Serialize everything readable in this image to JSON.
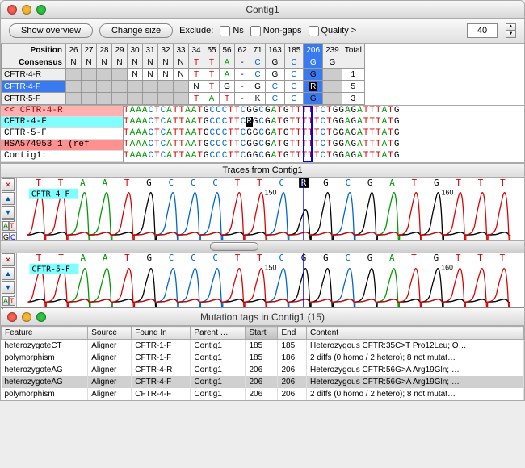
{
  "window": {
    "title": "Contig1"
  },
  "toolbar": {
    "overview_label": "Show overview",
    "changesize_label": "Change size",
    "exclude_label": "Exclude:",
    "ns_label": "Ns",
    "nongaps_label": "Non-gaps",
    "quality_label": "Quality >",
    "quality_value": "40"
  },
  "postable": {
    "position_label": "Position",
    "consensus_label": "Consensus",
    "columns": [
      {
        "pos": "26",
        "cons": "N"
      },
      {
        "pos": "27",
        "cons": "N"
      },
      {
        "pos": "28",
        "cons": "N"
      },
      {
        "pos": "29",
        "cons": "N"
      },
      {
        "pos": "30",
        "cons": "N"
      },
      {
        "pos": "31",
        "cons": "N"
      },
      {
        "pos": "32",
        "cons": "N"
      },
      {
        "pos": "33",
        "cons": "N"
      },
      {
        "pos": "34",
        "cons": "T"
      },
      {
        "pos": "55",
        "cons": "T"
      },
      {
        "pos": "56",
        "cons": "A"
      },
      {
        "pos": "62",
        "cons": "-"
      },
      {
        "pos": "71",
        "cons": "C"
      },
      {
        "pos": "163",
        "cons": "G"
      },
      {
        "pos": "185",
        "cons": "C"
      },
      {
        "pos": "206",
        "cons": "G",
        "hl": true
      },
      {
        "pos": "239",
        "cons": "G"
      }
    ],
    "total_label": "Total",
    "rows": [
      {
        "name": "CFTR-4-R",
        "cells": [
          "",
          "",
          "",
          "",
          "N",
          "N",
          "N",
          "N",
          "T",
          "T",
          "A",
          "-",
          "C",
          "G",
          "C",
          "G",
          ""
        ],
        "total": "1"
      },
      {
        "name": "CFTR-4-F",
        "hl": true,
        "cells": [
          "",
          "",
          "",
          "",
          "",
          "",
          "",
          "",
          "N",
          "T",
          "G",
          "-",
          "G",
          "C",
          "C",
          "R",
          ""
        ],
        "total": "5"
      },
      {
        "name": "CFTR-5-F",
        "cells": [
          "",
          "",
          "",
          "",
          "",
          "",
          "",
          "",
          "T",
          "A",
          "T",
          "-",
          "K",
          "C",
          "C",
          "G",
          ""
        ],
        "total": "3"
      }
    ]
  },
  "alignment": {
    "left": [
      {
        "label": "<< CFTR-4-R",
        "cls": "al-r"
      },
      {
        "label": "CFTR-4-F",
        "cls": "al-f"
      },
      {
        "label": "CFTR-5-F",
        "cls": ""
      },
      {
        "label": "HSA574953 1 (ref",
        "cls": "al-ref"
      },
      {
        "label": "Contig1:",
        "cls": ""
      }
    ],
    "cols": [
      "T",
      "A",
      "A",
      "A",
      "C",
      "T",
      "C",
      "A",
      "T",
      "T",
      "A",
      "A",
      "T",
      "G",
      "C",
      "C",
      "C",
      "T",
      "T",
      "C",
      "R",
      "G",
      "C",
      "G",
      "A",
      "T",
      "G",
      "T",
      "T",
      "T",
      "T",
      "T",
      "C",
      "T",
      "G",
      "G",
      "A",
      "G",
      "A",
      "T",
      "T",
      "T",
      "A",
      "T",
      "G"
    ],
    "variant": {
      "row1": "R",
      "row3": "G"
    }
  },
  "traces": {
    "header": "Traces from Contig1",
    "trace1": {
      "name": "CFTR-4-F",
      "bases": [
        "T",
        "T",
        "A",
        "A",
        "T",
        "G",
        "C",
        "C",
        "C",
        "T",
        "T",
        "C",
        "R",
        "G",
        "C",
        "G",
        "A",
        "T",
        "G",
        "T",
        "T",
        "T"
      ],
      "ticks": [
        "150",
        "160"
      ]
    },
    "trace2": {
      "name": "CFTR-5-F",
      "bases": [
        "T",
        "T",
        "A",
        "A",
        "T",
        "G",
        "C",
        "C",
        "C",
        "T",
        "T",
        "C",
        "G",
        "G",
        "C",
        "G",
        "A",
        "T",
        "G",
        "T",
        "T",
        "T"
      ],
      "ticks": [
        "150",
        "160"
      ]
    }
  },
  "mutwindow": {
    "title": "Mutation tags in Contig1 (15)",
    "headers": [
      "Feature",
      "Source",
      "Found In",
      "Parent …",
      "Start",
      "End",
      "Content"
    ],
    "sortcol": 4,
    "rows": [
      {
        "cells": [
          "heterozygoteCT",
          "Aligner",
          "CFTR-1-F",
          "Contig1",
          "185",
          "185",
          "Heterozygous CFTR:35C>T Pro12Leu; O…"
        ]
      },
      {
        "cells": [
          "polymorphism",
          "Aligner",
          "CFTR-1-F",
          "Contig1",
          "185",
          "186",
          "2 diffs (0 homo / 2 hetero); 8 not mutat…"
        ]
      },
      {
        "cells": [
          "heterozygoteAG",
          "Aligner",
          "CFTR-4-R",
          "Contig1",
          "206",
          "206",
          "Heterozygous CFTR:56G>A Arg19Gln; …"
        ]
      },
      {
        "cells": [
          "heterozygoteAG",
          "Aligner",
          "CFTR-4-F",
          "Contig1",
          "206",
          "206",
          "Heterozygous CFTR:56G>A Arg19Gln; …"
        ],
        "sel": true
      },
      {
        "cells": [
          "polymorphism",
          "Aligner",
          "CFTR-4-F",
          "Contig1",
          "206",
          "206",
          "2 diffs (0 homo / 2 hetero); 8 not mutat…"
        ]
      }
    ]
  },
  "colors": {
    "A": "green",
    "C": "blue",
    "G": "black",
    "T": "red",
    "N": "black",
    "R": "black",
    "K": "black",
    "-": "black"
  }
}
